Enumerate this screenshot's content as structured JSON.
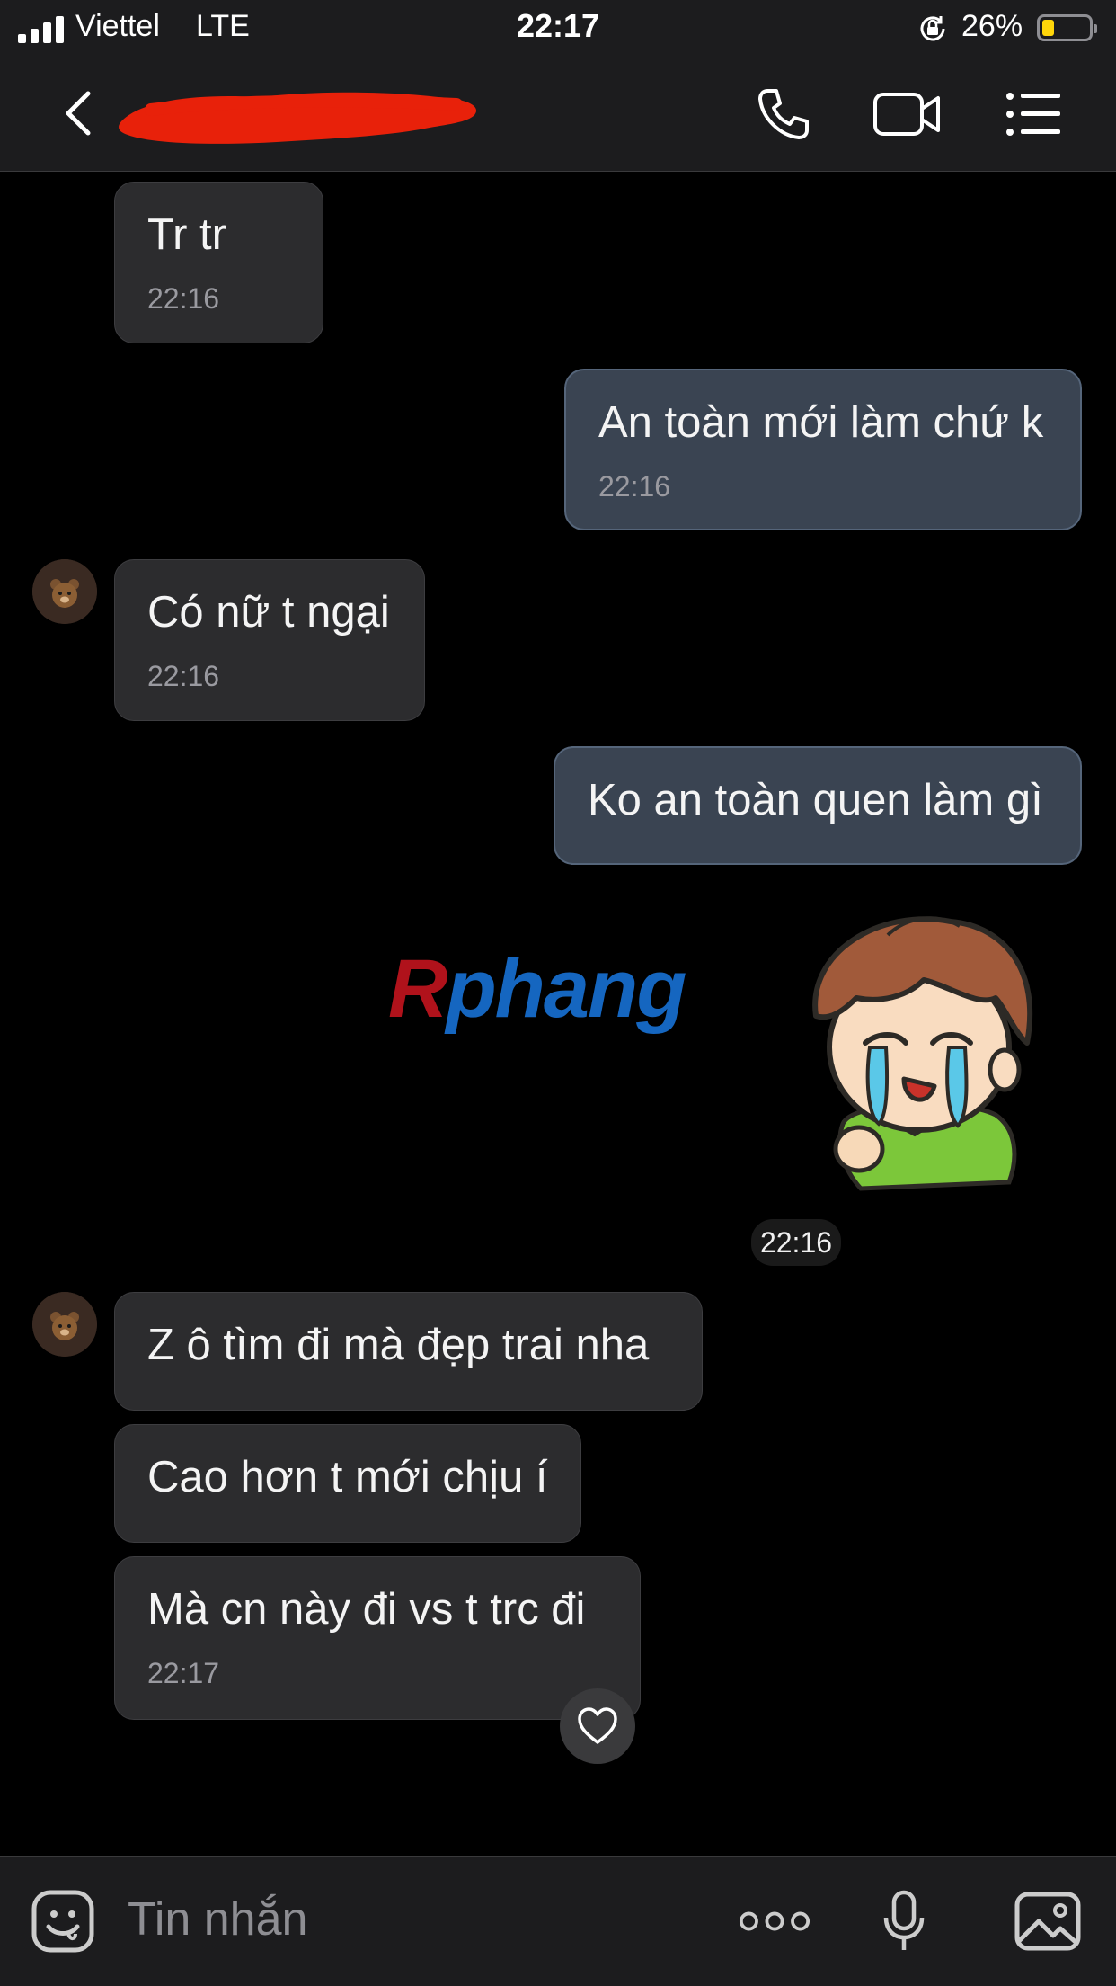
{
  "status_bar": {
    "carrier": "Viettel",
    "network": "LTE",
    "time": "22:17",
    "battery": "26%",
    "battery_level": 0.26
  },
  "header": {
    "contact_name_redacted": true
  },
  "messages": [
    {
      "dir": "in",
      "text": "Tr tr",
      "time": "22:16"
    },
    {
      "dir": "out",
      "text": "An toàn mới làm chứ k",
      "time": "22:16"
    },
    {
      "dir": "in",
      "text": "Có nữ t ngại",
      "time": "22:16"
    },
    {
      "dir": "out",
      "text": "Ko an toàn quen làm gì"
    },
    {
      "dir": "out",
      "type": "sticker",
      "time": "22:16"
    },
    {
      "dir": "in",
      "text": "Z ô tìm đi mà đẹp trai nha"
    },
    {
      "dir": "in",
      "text": "Cao hơn t mới chịu í"
    },
    {
      "dir": "in",
      "text": "Mà cn này đi vs t trc đi",
      "time": "22:17"
    }
  ],
  "watermark": {
    "first": "R",
    "rest": "phang"
  },
  "input": {
    "placeholder": "Tin nhắn"
  },
  "colors": {
    "incoming_bubble": "#2c2c2e",
    "outgoing_bubble": "#3a4452",
    "background": "#000000"
  }
}
